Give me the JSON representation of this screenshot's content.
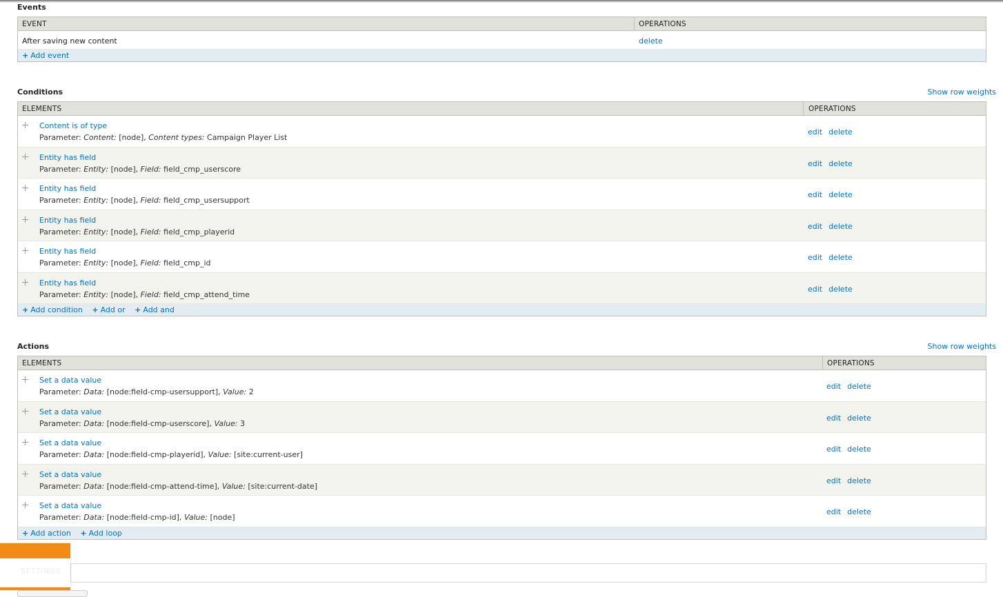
{
  "events": {
    "title": "Events",
    "headers": {
      "event": "EVENT",
      "operations": "OPERATIONS"
    },
    "rows": [
      {
        "name": "After saving new content",
        "op": "delete"
      }
    ],
    "add_event": "Add event"
  },
  "conditions": {
    "title": "Conditions",
    "row_weights": "Show row weights",
    "headers": {
      "elements": "ELEMENTS",
      "operations": "OPERATIONS"
    },
    "ops": {
      "edit": "edit",
      "delete": "delete"
    },
    "param_prefix": "Parameter:",
    "rows": [
      {
        "title": "Content is of type",
        "k1": "Content:",
        "v1": "[node],",
        "k2": "Content types:",
        "v2": "Campaign Player List"
      },
      {
        "title": "Entity has field",
        "k1": "Entity:",
        "v1": "[node],",
        "k2": "Field:",
        "v2": "field_cmp_userscore"
      },
      {
        "title": "Entity has field",
        "k1": "Entity:",
        "v1": "[node],",
        "k2": "Field:",
        "v2": "field_cmp_usersupport"
      },
      {
        "title": "Entity has field",
        "k1": "Entity:",
        "v1": "[node],",
        "k2": "Field:",
        "v2": "field_cmp_playerid"
      },
      {
        "title": "Entity has field",
        "k1": "Entity:",
        "v1": "[node],",
        "k2": "Field:",
        "v2": "field_cmp_id"
      },
      {
        "title": "Entity has field",
        "k1": "Entity:",
        "v1": "[node],",
        "k2": "Field:",
        "v2": "field_cmp_attend_time"
      }
    ],
    "add": {
      "condition": "Add condition",
      "or": "Add or",
      "and": "Add and"
    }
  },
  "actions": {
    "title": "Actions",
    "row_weights": "Show row weights",
    "headers": {
      "elements": "ELEMENTS",
      "operations": "OPERATIONS"
    },
    "ops": {
      "edit": "edit",
      "delete": "delete"
    },
    "param_prefix": "Parameter:",
    "rows": [
      {
        "title": "Set a data value",
        "k1": "Data:",
        "v1": "[node:field-cmp-usersupport],",
        "k2": "Value:",
        "v2": "2"
      },
      {
        "title": "Set a data value",
        "k1": "Data:",
        "v1": "[node:field-cmp-userscore],",
        "k2": "Value:",
        "v2": "3"
      },
      {
        "title": "Set a data value",
        "k1": "Data:",
        "v1": "[node:field-cmp-playerid],",
        "k2": "Value:",
        "v2": "[site:current-user]"
      },
      {
        "title": "Set a data value",
        "k1": "Data:",
        "v1": "[node:field-cmp-attend-time],",
        "k2": "Value:",
        "v2": "[site:current-date]"
      },
      {
        "title": "Set a data value",
        "k1": "Data:",
        "v1": "[node:field-cmp-id],",
        "k2": "Value:",
        "v2": "[node]"
      }
    ],
    "add": {
      "action": "Add action",
      "loop": "Add loop"
    }
  },
  "settings": {
    "label": "SETTINGS",
    "accent": "#f28a16"
  },
  "colors": {
    "link": "#0074bd",
    "header_bg": "#e1e2dc",
    "footer_bg": "#e3ecf3"
  }
}
